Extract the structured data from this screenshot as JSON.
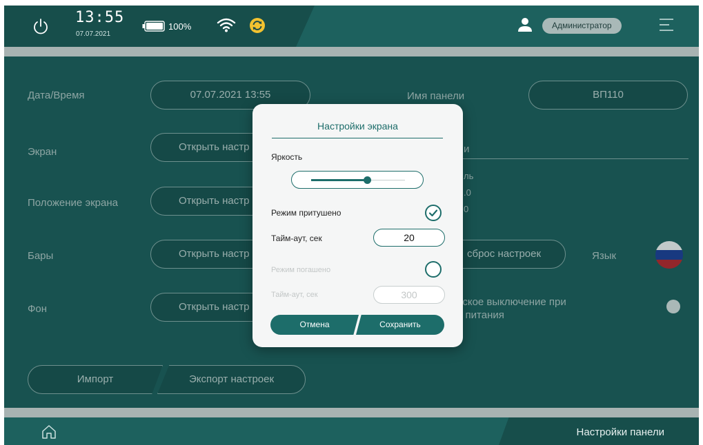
{
  "status": {
    "time": "13:55",
    "date": "07.07.2021",
    "battery": "100%",
    "user": "Администратор"
  },
  "bottom": {
    "title": "Настройки панели"
  },
  "settings": {
    "datetime_label": "Дата/Время",
    "datetime_value": "07.07.2021 13:55",
    "panel_name_label": "Имя панели",
    "panel_name_value": "ВП110",
    "screen_label": "Экран",
    "screen_button": "Открыть настр",
    "screen_position_label": "Положение экрана",
    "screen_position_button": "Открыть настр",
    "bars_label": "Бары",
    "bars_button": "Открыть настр",
    "background_label": "Фон",
    "background_button": "Открыть настр",
    "partial_right_1": "и",
    "partial_right_2": "ль",
    "partial_right_3": ".0",
    "partial_right_4": "0",
    "reset_button": "сброс настроек",
    "language_label": "Язык",
    "auto_off_line1": "еское выключение при",
    "auto_off_line2": "и питания",
    "import_button": "Импорт",
    "export_button": "Экспорт настроек"
  },
  "dialog": {
    "title": "Настройки экрана",
    "brightness_label": "Яркость",
    "brightness_level": 0.6,
    "dim_mode_label": "Режим притушено",
    "dim_mode_checked": true,
    "dim_timeout_label": "Тайм-аут, сек",
    "dim_timeout_value": "20",
    "off_mode_label": "Режим погашено",
    "off_mode_checked": false,
    "off_timeout_label": "Тайм-аут, сек",
    "off_timeout_value": "300",
    "cancel": "Отмена",
    "save": "Сохранить"
  },
  "colors": {
    "primary": "#1d615e",
    "accent": "#1d6d6a",
    "sync": "#f2c230"
  },
  "icons": [
    "power-icon",
    "battery-icon",
    "wifi-icon",
    "sync-icon",
    "user-icon",
    "menu-icon",
    "home-icon",
    "checkmark-icon",
    "flag-ru-icon"
  ]
}
